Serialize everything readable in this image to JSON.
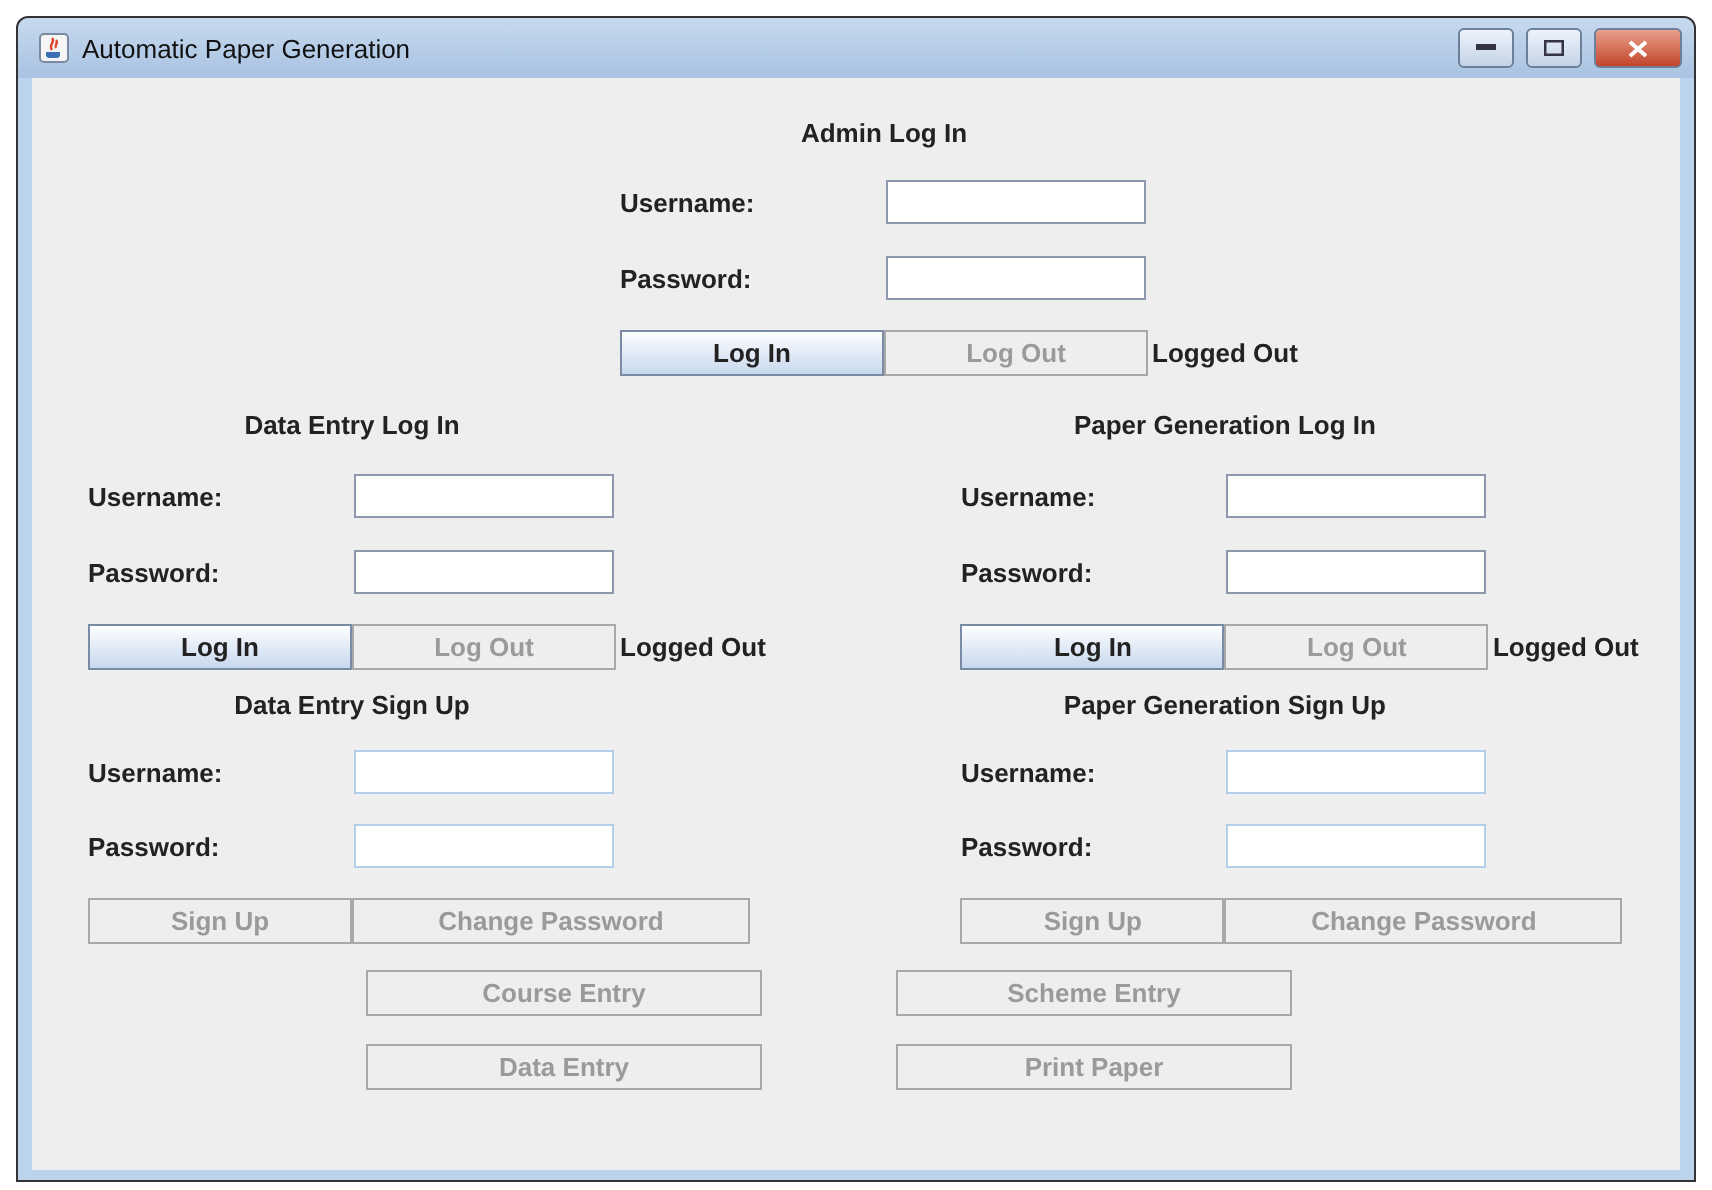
{
  "window": {
    "title": "Automatic Paper Generation"
  },
  "admin": {
    "title": "Admin Log In",
    "fields": [
      {
        "label": "Username:",
        "disabled": false
      },
      {
        "label": "Password:",
        "disabled": false
      }
    ],
    "buttons": [
      {
        "label": "Log In",
        "disabled": false
      },
      {
        "label": "Log Out",
        "disabled": true
      }
    ],
    "status": "Logged Out"
  },
  "panels": [
    {
      "login": {
        "title": "Data Entry Log In",
        "fields": [
          {
            "label": "Username:",
            "disabled": false
          },
          {
            "label": "Password:",
            "disabled": false
          }
        ],
        "buttons": [
          {
            "label": "Log In",
            "disabled": false
          },
          {
            "label": "Log Out",
            "disabled": true
          }
        ],
        "status": "Logged Out"
      },
      "signup": {
        "title": "Data Entry Sign Up",
        "fields": [
          {
            "label": "Username:",
            "disabled": true
          },
          {
            "label": "Password:",
            "disabled": true
          }
        ],
        "buttons": [
          {
            "label": "Sign Up",
            "disabled": true
          },
          {
            "label": "Change Password",
            "disabled": true
          }
        ]
      }
    },
    {
      "login": {
        "title": "Paper Generation Log In",
        "fields": [
          {
            "label": "Username:",
            "disabled": false
          },
          {
            "label": "Password:",
            "disabled": false
          }
        ],
        "buttons": [
          {
            "label": "Log In",
            "disabled": false
          },
          {
            "label": "Log Out",
            "disabled": true
          }
        ],
        "status": "Logged Out"
      },
      "signup": {
        "title": "Paper Generation Sign Up",
        "fields": [
          {
            "label": "Username:",
            "disabled": true
          },
          {
            "label": "Password:",
            "disabled": true
          }
        ],
        "buttons": [
          {
            "label": "Sign Up",
            "disabled": true
          },
          {
            "label": "Change Password",
            "disabled": true
          }
        ]
      }
    }
  ],
  "actions": [
    [
      {
        "label": "Course Entry",
        "disabled": true
      },
      {
        "label": "Scheme Entry",
        "disabled": true
      }
    ],
    [
      {
        "label": "Data Entry",
        "disabled": true
      },
      {
        "label": "Print Paper",
        "disabled": true
      }
    ]
  ]
}
